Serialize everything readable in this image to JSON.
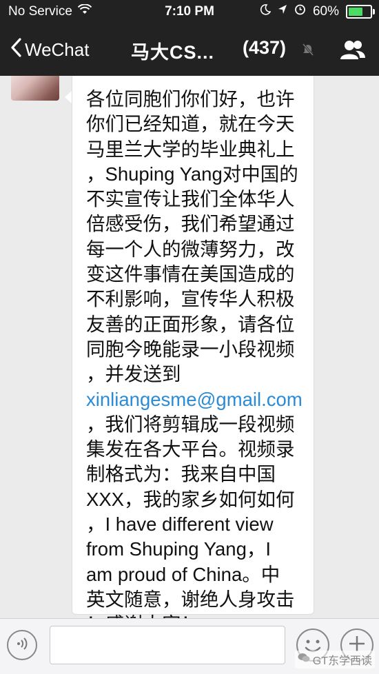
{
  "status_bar": {
    "carrier": "No Service",
    "time": "7:10 PM",
    "battery": "60%",
    "battery_level": 0.6,
    "icons": [
      "wifi-icon",
      "moon-icon",
      "location-icon",
      "alarm-icon",
      "battery-icon"
    ]
  },
  "nav": {
    "back_label": "WeChat",
    "title": "马大CS...",
    "count": "(437)",
    "icons": [
      "back-chevron-icon",
      "mute-icon",
      "contacts-icon"
    ]
  },
  "message": {
    "lines": [
      "各位同胞们你们好，也许",
      "你们已经知道，就在今天",
      "马里兰大学的毕业典礼上",
      "，Shuping Yang对中国的",
      "不实宣传让我们全体华人",
      "倍感受伤，我们希望通过",
      "每一个人的微薄努力，改",
      "变这件事情在美国造成的",
      "不利影响，宣传华人积极",
      "友善的正面形象，请各位",
      "同胞今晚能录一小段视频",
      "，并发送到",
      "xinliangesme@gmail.com",
      "，我们将剪辑成一段视频",
      "集发在各大平台。视频录",
      "制格式为：我来自中国",
      "XXX，我的家乡如何如何",
      "，I have different view",
      "from Shuping Yang，I",
      "am proud of China。中",
      "英文随意，谢绝人身攻击",
      "！感谢大家！"
    ],
    "email_line_index": 12,
    "colors": {
      "text": "#111111",
      "email": "#2a8bd6"
    }
  },
  "input_bar": {
    "icons": [
      "voice-icon",
      "emoji-icon",
      "plus-icon"
    ]
  },
  "watermark": {
    "text": "GT东学西读"
  }
}
